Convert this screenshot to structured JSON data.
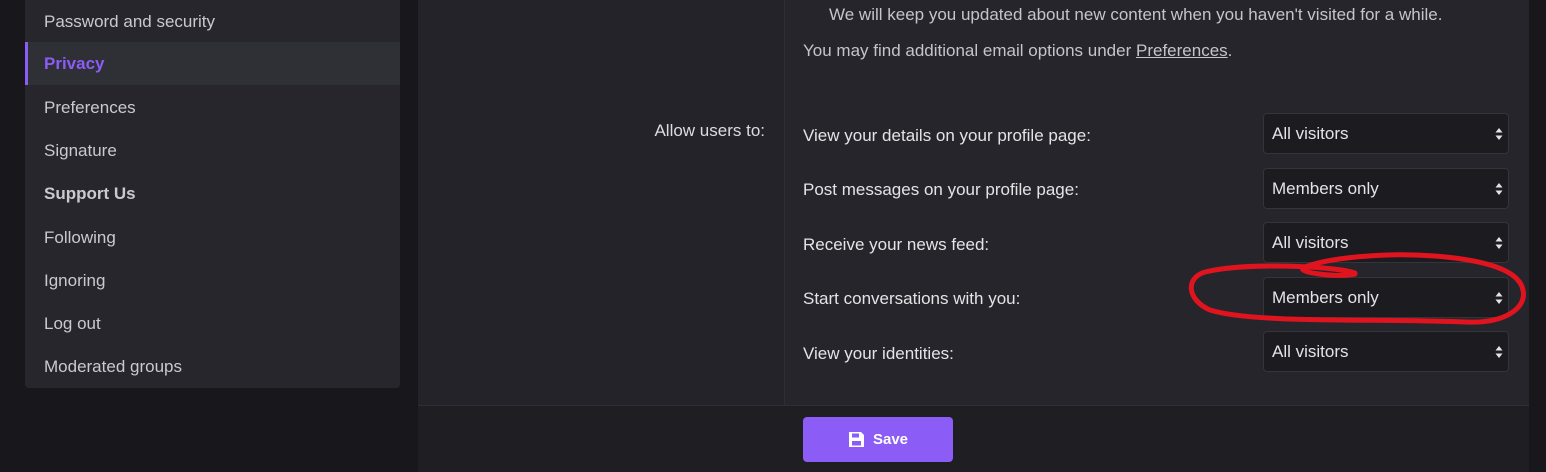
{
  "sidebar": {
    "items": [
      {
        "label": "Password and security"
      },
      {
        "label": "Privacy"
      },
      {
        "label": "Preferences"
      },
      {
        "label": "Signature"
      },
      {
        "label": "Support Us"
      },
      {
        "label": "Following"
      },
      {
        "label": "Ignoring"
      },
      {
        "label": "Log out"
      },
      {
        "label": "Moderated groups"
      }
    ]
  },
  "main": {
    "note_updates": "We will keep you updated about new content when you haven't visited for a while.",
    "note_email_prefix": "You may find additional email options under",
    "note_email_link": "Preferences",
    "note_email_suffix": ".",
    "allow_label": "Allow users to:",
    "settings": [
      {
        "label": "View your details on your profile page:",
        "value": "All visitors"
      },
      {
        "label": "Post messages on your profile page:",
        "value": "Members only"
      },
      {
        "label": "Receive your news feed:",
        "value": "All visitors"
      },
      {
        "label": "Start conversations with you:",
        "value": "Members only"
      },
      {
        "label": "View your identities:",
        "value": "All visitors"
      }
    ]
  },
  "footer": {
    "save_label": "Save"
  },
  "colors": {
    "accent": "#8b5cf6",
    "annotation": "#e0141e"
  }
}
